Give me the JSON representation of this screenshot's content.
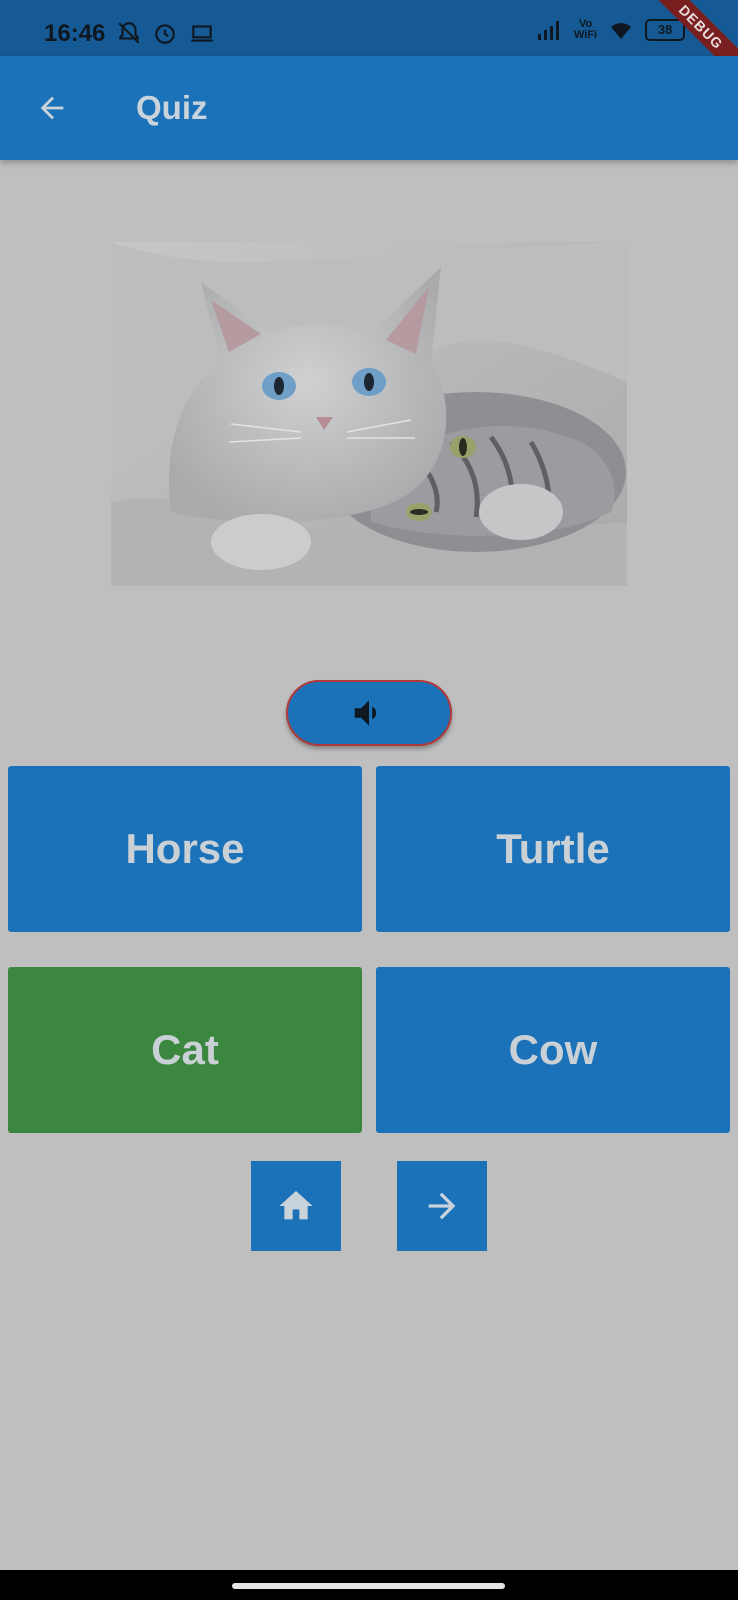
{
  "status_bar": {
    "time": "16:46",
    "vowifi_top": "Vo",
    "vowifi_bottom": "WiFi",
    "battery": "38",
    "debug_label": "DEBUG"
  },
  "app_bar": {
    "title": "Quiz"
  },
  "answers": [
    {
      "label": "Horse",
      "state": "default"
    },
    {
      "label": "Turtle",
      "state": "default"
    },
    {
      "label": "Cat",
      "state": "correct"
    },
    {
      "label": "Cow",
      "state": "default"
    }
  ],
  "colors": {
    "primary": "#1b72b9",
    "correct": "#3c873f",
    "background": "#bfbfbf",
    "sound_border": "#b03a3a"
  },
  "icons": {
    "back": "arrow-back-icon",
    "sound": "volume-up-icon",
    "home": "home-icon",
    "next": "arrow-forward-icon"
  }
}
